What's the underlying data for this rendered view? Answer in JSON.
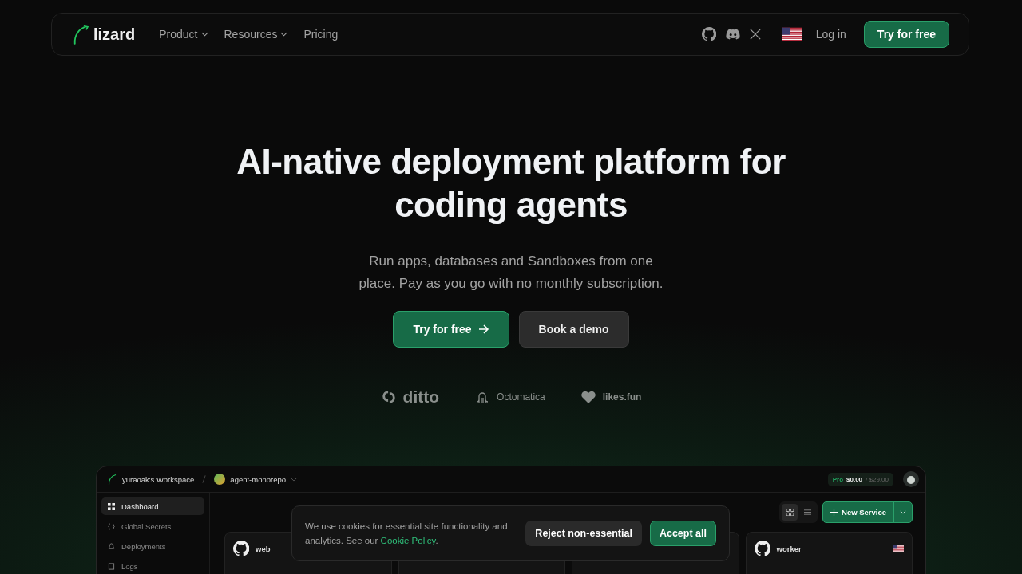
{
  "nav": {
    "logo": "lizard",
    "items": [
      {
        "label": "Product",
        "dropdown": true
      },
      {
        "label": "Resources",
        "dropdown": true
      },
      {
        "label": "Pricing",
        "dropdown": false
      }
    ],
    "login": "Log in",
    "cta": "Try for free"
  },
  "hero": {
    "title": "AI-native deployment platform for coding agents",
    "subtitle": "Run apps, databases and Sandboxes from one place. Pay as you go with no monthly subscription.",
    "buttons": [
      {
        "label": "Try for free",
        "kind": "primary"
      },
      {
        "label": "Book a demo",
        "kind": "secondary"
      }
    ]
  },
  "logos": [
    {
      "name": "ditto",
      "kind": "ditto"
    },
    {
      "name": "Octomatica",
      "kind": "octomatica"
    },
    {
      "name": "likes.fun",
      "kind": "likes"
    }
  ],
  "dashboard": {
    "workspace": "yuraoak's Workspace",
    "project": "agent-monorepo",
    "plan": {
      "tier": "Pro",
      "used": "$0.00",
      "limit": "/ $29.00"
    },
    "sidebar": [
      {
        "label": "Dashboard",
        "selected": true
      },
      {
        "label": "Global Secrets",
        "selected": false
      },
      {
        "label": "Deployments",
        "selected": false
      },
      {
        "label": "Logs",
        "selected": false
      }
    ],
    "views": [
      {
        "kind": "grid",
        "selected": true
      },
      {
        "kind": "list",
        "selected": false
      }
    ],
    "new_service": "New Service",
    "cards": [
      {
        "kind": "service",
        "name": "web",
        "flag": false
      },
      {
        "kind": "blank"
      },
      {
        "kind": "blank"
      },
      {
        "kind": "service",
        "name": "worker",
        "flag": true
      }
    ]
  },
  "cookie": {
    "text": "We use cookies for essential site functionality and analytics. See our",
    "link": "Cookie Policy",
    "after": ".",
    "buttons": [
      {
        "label": "Reject non-essential",
        "kind": "secondary"
      },
      {
        "label": "Accept all",
        "kind": "primary"
      }
    ]
  }
}
